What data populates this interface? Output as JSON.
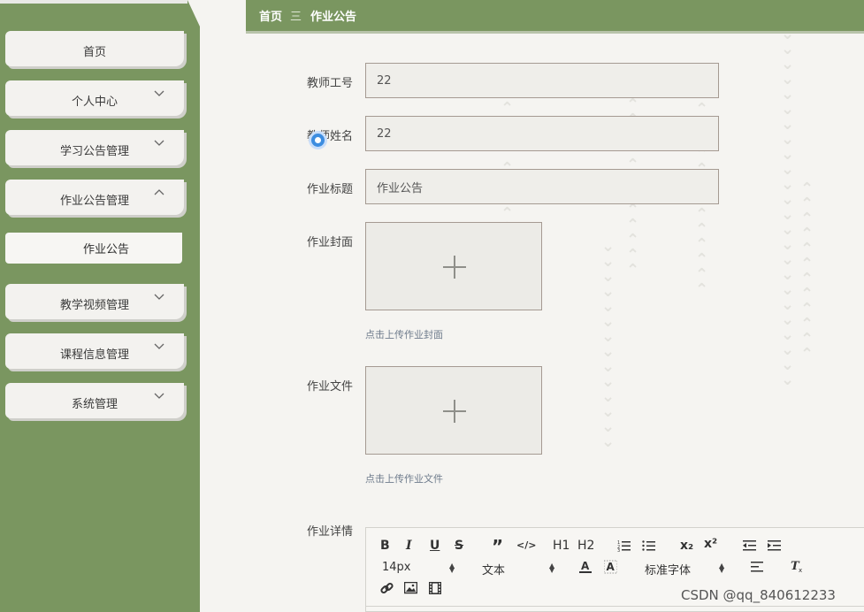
{
  "sidebar": {
    "items": [
      {
        "label": "首页",
        "has_chevron": false
      },
      {
        "label": "个人中心",
        "has_chevron": true,
        "chevron": "down"
      },
      {
        "label": "学习公告管理",
        "has_chevron": true,
        "chevron": "down"
      },
      {
        "label": "作业公告管理",
        "has_chevron": true,
        "chevron": "up"
      },
      {
        "label": "教学视频管理",
        "has_chevron": true,
        "chevron": "down"
      },
      {
        "label": "课程信息管理",
        "has_chevron": true,
        "chevron": "down"
      },
      {
        "label": "系统管理",
        "has_chevron": true,
        "chevron": "down"
      }
    ],
    "submenu": [
      {
        "label": "作业公告"
      }
    ]
  },
  "breadcrumb": {
    "home": "首页",
    "separator": "三",
    "current": "作业公告"
  },
  "form": {
    "teacher_id": {
      "label": "教师工号",
      "value": "22"
    },
    "teacher_name": {
      "label": "教师姓名",
      "value": "22"
    },
    "title": {
      "label": "作业标题",
      "value": "作业公告"
    },
    "cover": {
      "label": "作业封面",
      "hint": "点击上传作业封面"
    },
    "file": {
      "label": "作业文件",
      "hint": "点击上传作业文件"
    },
    "details": {
      "label": "作业详情"
    }
  },
  "editor_toolbar": {
    "bold": "B",
    "italic": "I",
    "underline": "U",
    "strike": "S",
    "quote": "”",
    "code": "</>",
    "h1": "H1",
    "h2": "H2",
    "subscript": "x₂",
    "superscript": "x²",
    "font_size": "14px",
    "text_style": "文本",
    "font_family": "标准字体"
  },
  "watermark": "CSDN @qq_840612233",
  "colors": {
    "sidebar_bg": "#7a9660",
    "header_bg": "#7a9660",
    "page_bg": "#f5f4f1",
    "input_bg": "#efeeea",
    "input_border": "#a59a92"
  }
}
